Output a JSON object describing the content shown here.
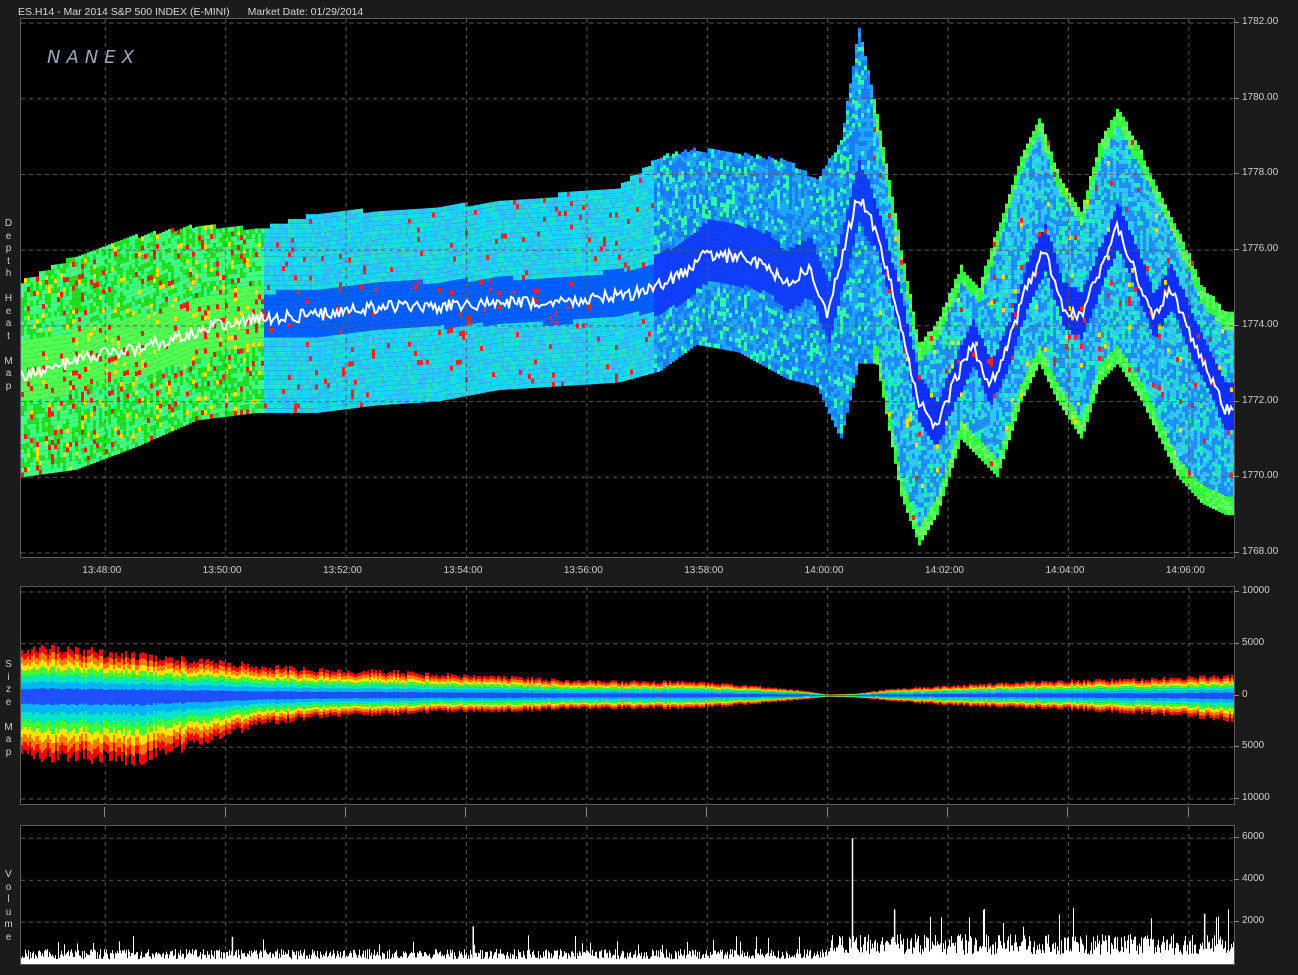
{
  "header": {
    "instrument": "ES.H14 - Mar 2014 S&P 500 INDEX (E-MINI)",
    "market_date": "Market Date: 01/29/2014"
  },
  "logo": "NANEX",
  "panels": {
    "heatmap_label": [
      "D",
      "e",
      "p",
      "t",
      "h",
      "",
      "H",
      "e",
      "a",
      "t",
      "",
      "M",
      "a",
      "p"
    ],
    "size_label": [
      "S",
      "i",
      "z",
      "e",
      "",
      "M",
      "a",
      "p"
    ],
    "volume_label": [
      "V",
      "o",
      "l",
      "u",
      "m",
      "e"
    ]
  },
  "colors": {
    "background": "#000000",
    "grid": "#5a5a5a",
    "price_line": "#ffffff",
    "scale": [
      "#ff0000",
      "#ff7a00",
      "#ffe600",
      "#3cff3c",
      "#00e6c8",
      "#00b4ff",
      "#1e50ff"
    ]
  },
  "chart_data": [
    {
      "type": "heatmap",
      "ylabel": "",
      "ylim": [
        1768,
        1782
      ],
      "y_ticks": [
        "1782.00",
        "1780.00",
        "1778.00",
        "1776.00",
        "1774.00",
        "1772.00",
        "1770.00",
        "1768.00"
      ],
      "y_tick_values": [
        1782,
        1780,
        1778,
        1776,
        1774,
        1772,
        1770,
        1768
      ],
      "x_ticks": [
        "13:48:00",
        "13:50:00",
        "13:52:00",
        "13:54:00",
        "13:56:00",
        "13:58:00",
        "14:00:00",
        "14:02:00",
        "14:04:00",
        "14:06:00"
      ],
      "x_tick_minutes": [
        828,
        830,
        832,
        834,
        836,
        838,
        840,
        842,
        844,
        846
      ],
      "xlim_minutes": [
        826.6,
        846.75
      ],
      "price_series": {
        "x_minutes": [
          826.6,
          827.2,
          827.8,
          828.5,
          829.2,
          829.8,
          830.6,
          831.5,
          832.5,
          833.5,
          834.5,
          835.5,
          836.5,
          837.0,
          837.5,
          838.0,
          838.5,
          839.0,
          839.3,
          839.7,
          840.0,
          840.3,
          840.5,
          840.8,
          841.2,
          841.5,
          841.8,
          842.1,
          842.4,
          842.7,
          843.0,
          843.3,
          843.6,
          843.9,
          844.2,
          844.5,
          844.8,
          845.1,
          845.4,
          845.7,
          846.0,
          846.3,
          846.6
        ],
        "price": [
          1772.7,
          1772.9,
          1773.2,
          1773.4,
          1773.7,
          1774.0,
          1774.2,
          1774.3,
          1774.5,
          1774.5,
          1774.6,
          1774.6,
          1774.8,
          1774.9,
          1775.3,
          1775.9,
          1775.8,
          1775.6,
          1775.1,
          1775.5,
          1774.3,
          1776.2,
          1777.5,
          1776.5,
          1774.2,
          1772.0,
          1771.3,
          1772.5,
          1773.5,
          1772.4,
          1773.5,
          1775.0,
          1776.0,
          1774.5,
          1774.2,
          1775.4,
          1776.6,
          1775.5,
          1774.2,
          1775.0,
          1773.8,
          1772.8,
          1771.8
        ]
      },
      "depth_band": {
        "x_minutes": [
          826.6,
          827.5,
          828.5,
          829.5,
          830.5,
          831.5,
          832.5,
          833.5,
          834.5,
          835.5,
          836.5,
          837.2,
          837.8,
          838.5,
          839.3,
          839.8,
          840.2,
          840.5,
          840.8,
          841.2,
          841.5,
          841.8,
          842.2,
          842.5,
          842.8,
          843.2,
          843.5,
          843.8,
          844.2,
          844.5,
          844.8,
          845.2,
          845.5,
          845.8,
          846.2,
          846.6
        ],
        "upper": [
          1775.1,
          1775.8,
          1776.3,
          1776.6,
          1776.5,
          1776.9,
          1777.0,
          1777.1,
          1777.2,
          1777.4,
          1777.6,
          1778.4,
          1778.6,
          1778.5,
          1778.3,
          1777.8,
          1778.8,
          1781.8,
          1779.6,
          1776.0,
          1773.5,
          1774.0,
          1775.5,
          1775.0,
          1776.5,
          1778.5,
          1779.5,
          1778.0,
          1777.0,
          1778.8,
          1779.7,
          1778.5,
          1777.5,
          1776.5,
          1775.0,
          1774.3
        ],
        "lower": [
          1770.0,
          1770.2,
          1770.8,
          1771.5,
          1771.7,
          1771.7,
          1771.9,
          1772.0,
          1772.3,
          1772.4,
          1772.5,
          1772.8,
          1773.5,
          1773.3,
          1772.6,
          1772.4,
          1771.0,
          1773.0,
          1773.0,
          1769.5,
          1768.2,
          1769.0,
          1771.0,
          1770.5,
          1770.0,
          1772.0,
          1773.0,
          1772.0,
          1771.0,
          1772.5,
          1773.0,
          1772.0,
          1771.0,
          1770.0,
          1769.3,
          1769.0
        ]
      }
    },
    {
      "type": "area",
      "ylim": [
        -10000,
        10000
      ],
      "y_ticks": [
        "10000",
        "5000",
        "0",
        "5000",
        "10000"
      ],
      "y_tick_values": [
        10000,
        5000,
        0,
        -5000,
        -10000
      ],
      "x_minutes": [
        826.6,
        827.5,
        828.5,
        829.5,
        830.5,
        831.5,
        832.5,
        833.5,
        834.5,
        835.5,
        836.5,
        837.5,
        838.5,
        839.5,
        840.0,
        840.5,
        841.0,
        842.0,
        843.0,
        844.0,
        845.0,
        846.0,
        846.6
      ],
      "upper": [
        4500,
        4300,
        3800,
        3300,
        2800,
        2400,
        2300,
        2000,
        1800,
        1500,
        1300,
        1300,
        1000,
        500,
        100,
        200,
        600,
        900,
        1200,
        1400,
        1500,
        1700,
        1800
      ],
      "lower": [
        -5800,
        -5800,
        -6200,
        -4500,
        -2800,
        -2000,
        -1800,
        -1500,
        -1500,
        -1300,
        -1200,
        -1200,
        -900,
        -400,
        -100,
        -200,
        -500,
        -900,
        -1100,
        -1300,
        -1600,
        -1900,
        -2300
      ]
    },
    {
      "type": "bar",
      "ylim": [
        0,
        6300
      ],
      "y_ticks": [
        "6000",
        "4000",
        "2000"
      ],
      "y_tick_values": [
        6000,
        4000,
        2000
      ],
      "spikes": [
        {
          "x_minute": 840.4,
          "value": 6000
        },
        {
          "x_minute": 841.1,
          "value": 2600
        },
        {
          "x_minute": 846.25,
          "value": 2400
        },
        {
          "x_minute": 830.1,
          "value": 1300
        },
        {
          "x_minute": 834.1,
          "value": 1800
        }
      ],
      "baseline_before": 550,
      "baseline_after": 1100
    }
  ]
}
